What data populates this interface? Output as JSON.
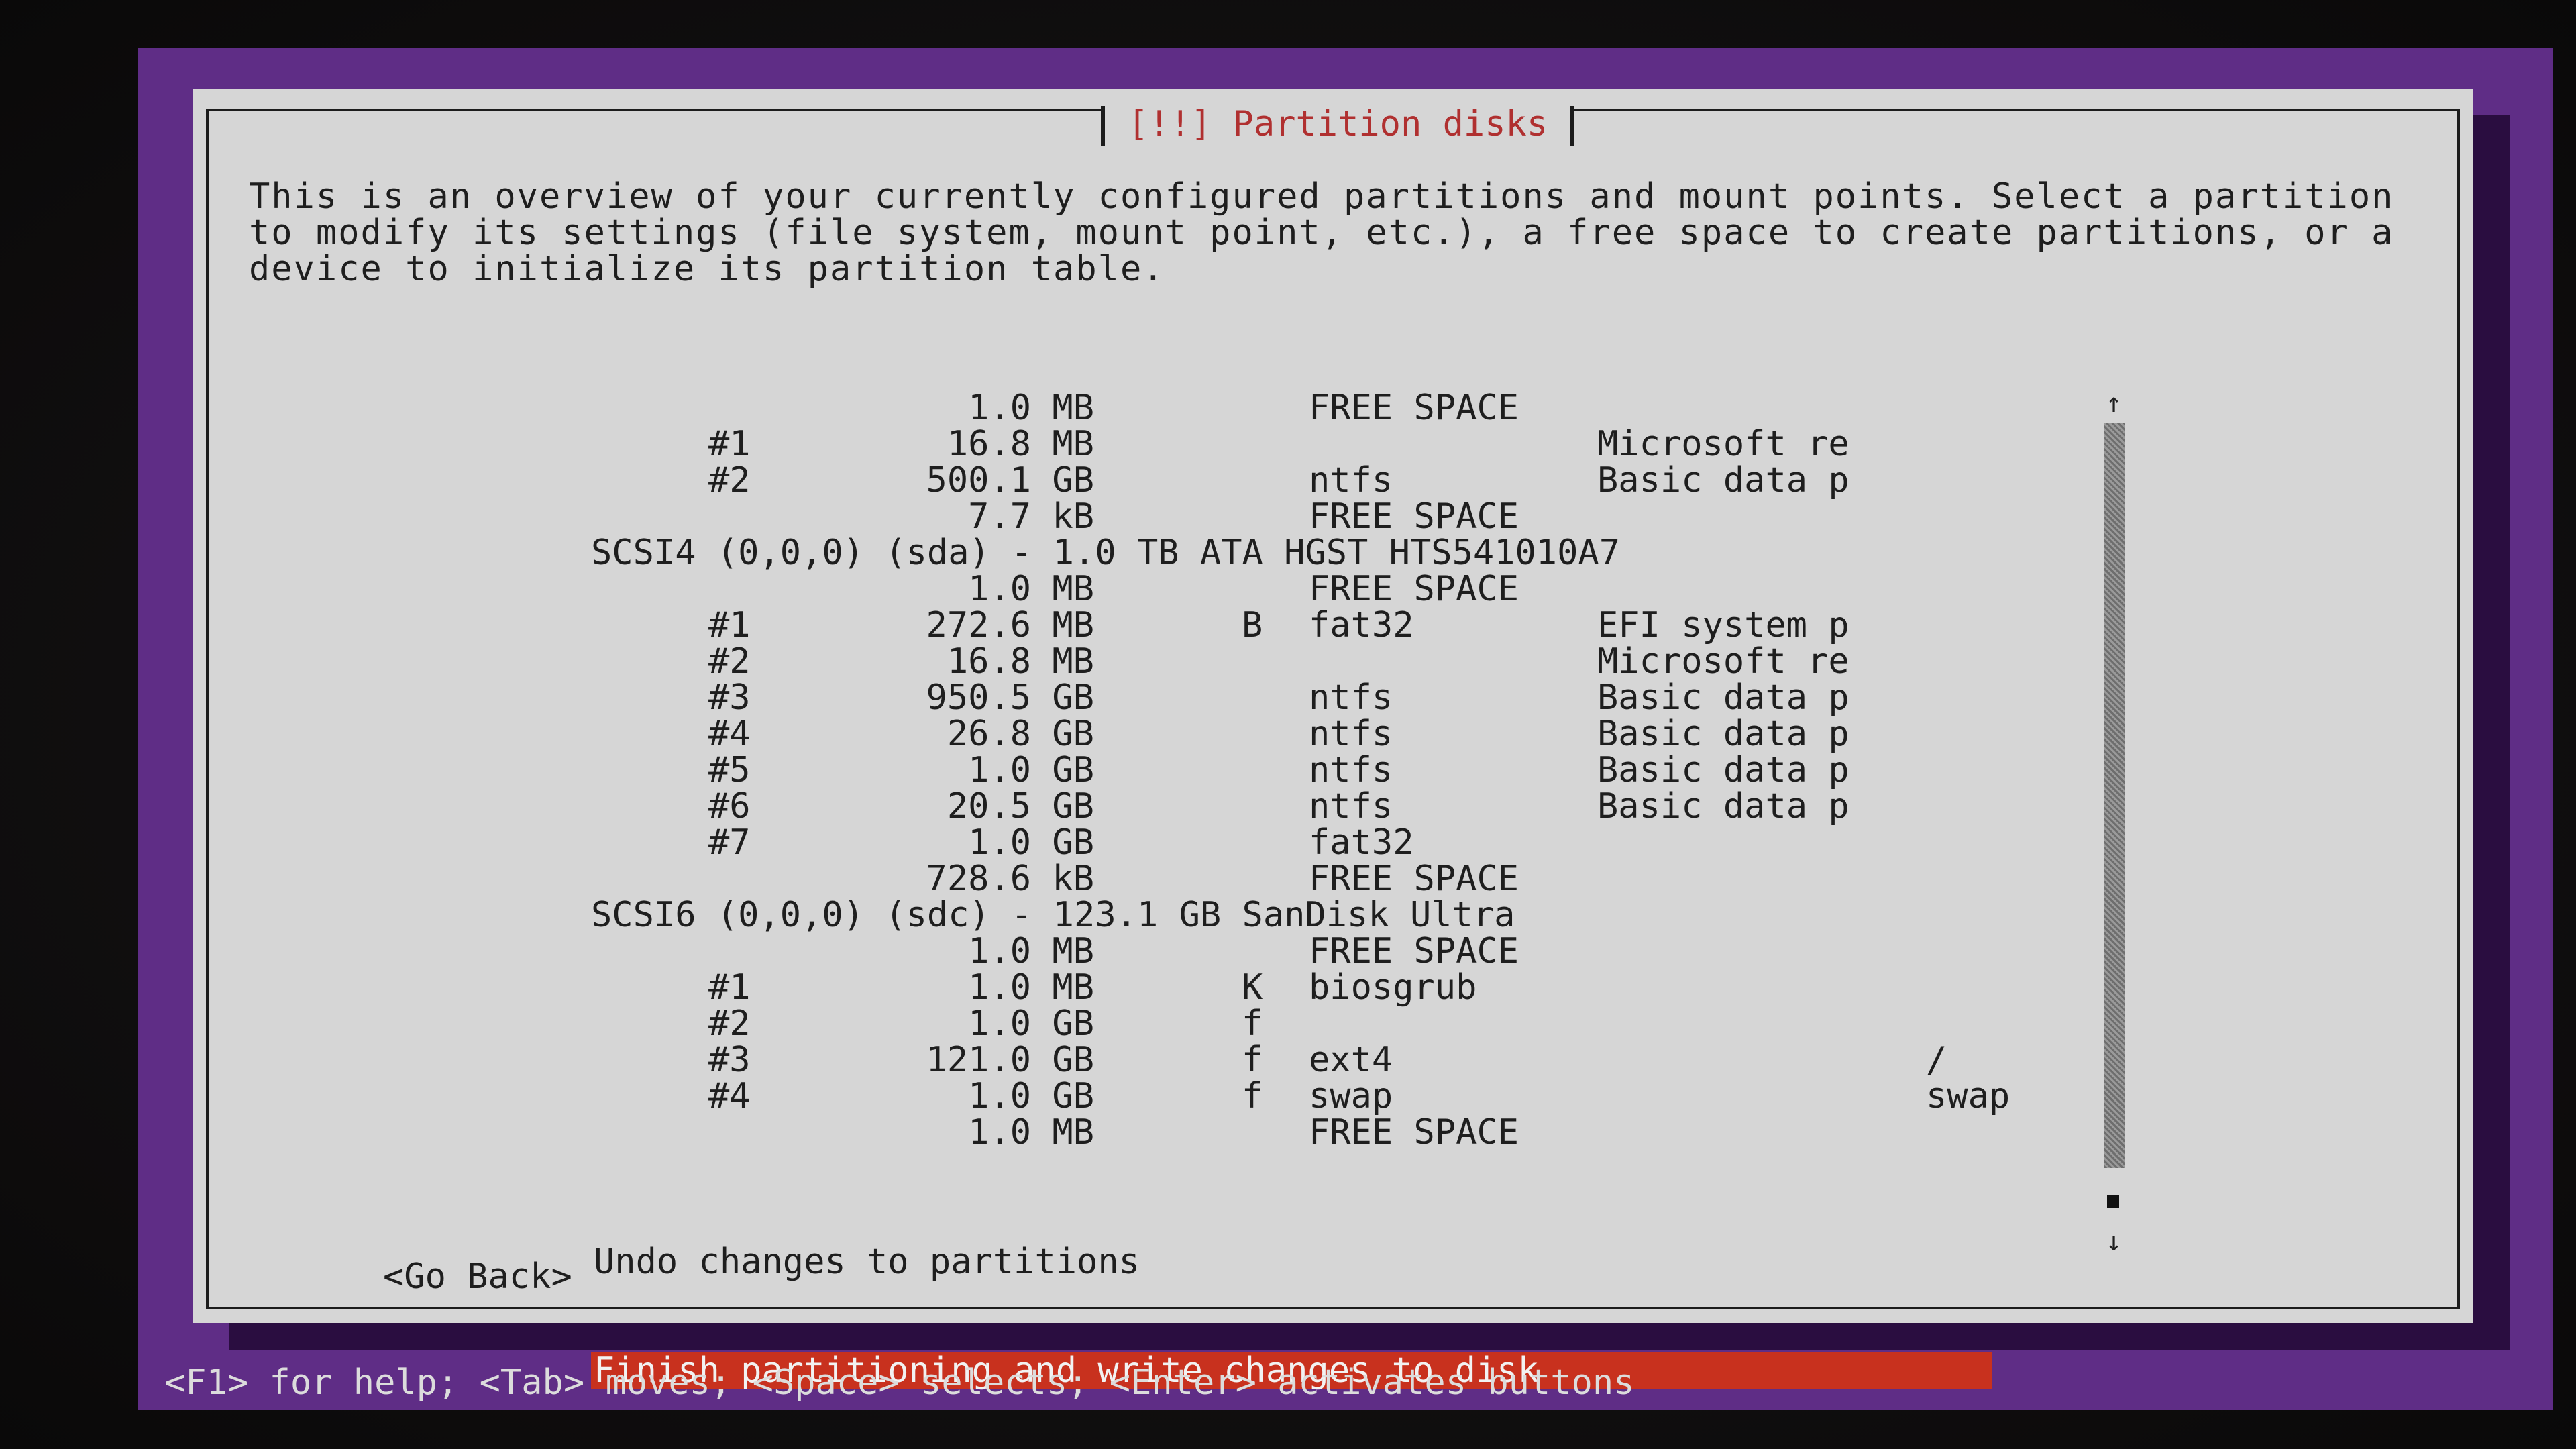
{
  "dialog": {
    "title": "[!!] Partition disks",
    "intro": "This is an overview of your currently configured partitions and mount points. Select a partition to modify its settings (file system, mount point, etc.), a free space to create partitions, or a device to initialize its partition table."
  },
  "rows": [
    {
      "type": "part",
      "num": "",
      "size": "1.0 MB",
      "flag": "",
      "fs": "FREE SPACE",
      "label": "",
      "mount": ""
    },
    {
      "type": "part",
      "num": "#1",
      "size": "16.8 MB",
      "flag": "",
      "fs": "",
      "label": "Microsoft re",
      "mount": ""
    },
    {
      "type": "part",
      "num": "#2",
      "size": "500.1 GB",
      "flag": "",
      "fs": "ntfs",
      "label": "Basic data p",
      "mount": ""
    },
    {
      "type": "part",
      "num": "",
      "size": "7.7 kB",
      "flag": "",
      "fs": "FREE SPACE",
      "label": "",
      "mount": ""
    },
    {
      "type": "disk",
      "text": "SCSI4 (0,0,0) (sda) - 1.0 TB ATA HGST HTS541010A7"
    },
    {
      "type": "part",
      "num": "",
      "size": "1.0 MB",
      "flag": "",
      "fs": "FREE SPACE",
      "label": "",
      "mount": ""
    },
    {
      "type": "part",
      "num": "#1",
      "size": "272.6 MB",
      "flag": "B",
      "fs": "fat32",
      "label": "EFI system p",
      "mount": ""
    },
    {
      "type": "part",
      "num": "#2",
      "size": "16.8 MB",
      "flag": "",
      "fs": "",
      "label": "Microsoft re",
      "mount": ""
    },
    {
      "type": "part",
      "num": "#3",
      "size": "950.5 GB",
      "flag": "",
      "fs": "ntfs",
      "label": "Basic data p",
      "mount": ""
    },
    {
      "type": "part",
      "num": "#4",
      "size": "26.8 GB",
      "flag": "",
      "fs": "ntfs",
      "label": "Basic data p",
      "mount": ""
    },
    {
      "type": "part",
      "num": "#5",
      "size": "1.0 GB",
      "flag": "",
      "fs": "ntfs",
      "label": "Basic data p",
      "mount": ""
    },
    {
      "type": "part",
      "num": "#6",
      "size": "20.5 GB",
      "flag": "",
      "fs": "ntfs",
      "label": "Basic data p",
      "mount": ""
    },
    {
      "type": "part",
      "num": "#7",
      "size": "1.0 GB",
      "flag": "",
      "fs": "fat32",
      "label": "",
      "mount": ""
    },
    {
      "type": "part",
      "num": "",
      "size": "728.6 kB",
      "flag": "",
      "fs": "FREE SPACE",
      "label": "",
      "mount": ""
    },
    {
      "type": "disk",
      "text": "SCSI6 (0,0,0) (sdc) - 123.1 GB SanDisk Ultra"
    },
    {
      "type": "part",
      "num": "",
      "size": "1.0 MB",
      "flag": "",
      "fs": "FREE SPACE",
      "label": "",
      "mount": ""
    },
    {
      "type": "part",
      "num": "#1",
      "size": "1.0 MB",
      "flag": "K",
      "fs": "biosgrub",
      "label": "",
      "mount": ""
    },
    {
      "type": "part",
      "num": "#2",
      "size": "1.0 GB",
      "flag": "f",
      "fs": "",
      "label": "",
      "mount": ""
    },
    {
      "type": "part",
      "num": "#3",
      "size": "121.0 GB",
      "flag": "f",
      "fs": "ext4",
      "label": "",
      "mount": "/"
    },
    {
      "type": "part",
      "num": "#4",
      "size": "1.0 GB",
      "flag": "f",
      "fs": "swap",
      "label": "",
      "mount": "swap"
    },
    {
      "type": "part",
      "num": "",
      "size": "1.0 MB",
      "flag": "",
      "fs": "FREE SPACE",
      "label": "",
      "mount": ""
    }
  ],
  "actions": {
    "undo": "Undo changes to partitions",
    "finish": "Finish partitioning and write changes to disk"
  },
  "scrollbar": {
    "up_icon": "↑",
    "down_icon": "↓"
  },
  "buttons": {
    "go_back": "<Go Back>"
  },
  "help_bar": "<F1> for help; <Tab> moves; <Space> selects; <Enter> activates buttons",
  "colors": {
    "background": "#5f2d86",
    "dialog": "#d6d6d6",
    "title_text": "#b03030",
    "selection": "#c8311e"
  }
}
